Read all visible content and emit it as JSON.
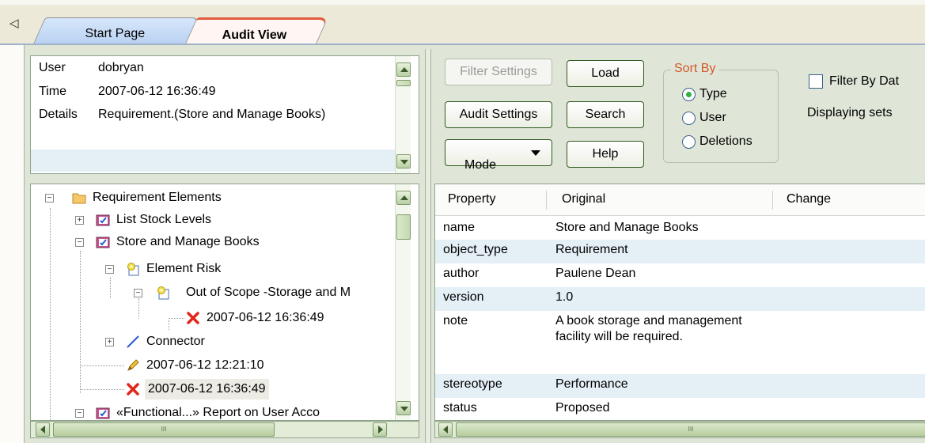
{
  "tabs": {
    "left_arrow": "◁",
    "items": [
      {
        "label": "Start Page",
        "active": false
      },
      {
        "label": "Audit View",
        "active": true
      }
    ]
  },
  "details": {
    "rows": [
      {
        "label": "User",
        "value": "dobryan"
      },
      {
        "label": "Time",
        "value": "2007-06-12 16:36:49"
      },
      {
        "label": "Details",
        "value": "Requirement.(Store and Manage Books)"
      }
    ]
  },
  "tree": {
    "nodes": [
      {
        "label": "Requirement Elements",
        "icon": "folder-icon",
        "expander": "−"
      },
      {
        "label": "List Stock Levels",
        "icon": "requirement-icon",
        "expander": "+"
      },
      {
        "label": "Store and Manage Books",
        "icon": "requirement-icon",
        "expander": "−"
      },
      {
        "label": "Element Risk",
        "icon": "risk-icon",
        "expander": "−"
      },
      {
        "label": "Out of Scope -Storage and M",
        "icon": "risk-icon",
        "expander": "−"
      },
      {
        "label": "2007-06-12 16:36:49",
        "icon": "delete-x-icon",
        "expander": ""
      },
      {
        "label": "Connector",
        "icon": "connector-icon",
        "expander": "+"
      },
      {
        "label": "2007-06-12 12:21:10",
        "icon": "pencil-icon",
        "expander": ""
      },
      {
        "label": "2007-06-12 16:36:49",
        "icon": "delete-x-icon",
        "expander": ""
      },
      {
        "label": "«Functional...» Report on User Acco",
        "icon": "requirement-icon",
        "expander": "−"
      }
    ]
  },
  "toolbar": {
    "filter_settings": "Filter Settings",
    "audit_settings": "Audit Settings",
    "mode": "Mode",
    "load": "Load",
    "search": "Search",
    "help": "Help",
    "filter_by_date": "Filter By Dat",
    "displaying_sets": "Displaying sets"
  },
  "sort_by": {
    "title": "Sort By",
    "options": [
      {
        "label": "Type",
        "selected": true
      },
      {
        "label": "User",
        "selected": false
      },
      {
        "label": "Deletions",
        "selected": false
      }
    ]
  },
  "grid": {
    "columns": [
      "Property",
      "Original",
      "Change"
    ],
    "rows": [
      {
        "property": "name",
        "original": "Store and Manage Books",
        "change": ""
      },
      {
        "property": "object_type",
        "original": "Requirement",
        "change": ""
      },
      {
        "property": "author",
        "original": "Paulene Dean",
        "change": ""
      },
      {
        "property": "version",
        "original": "1.0",
        "change": ""
      },
      {
        "property": "note",
        "original": "A book storage and management facility will be required.",
        "change": ""
      },
      {
        "property": "stereotype",
        "original": "Performance",
        "change": ""
      },
      {
        "property": "status",
        "original": "Proposed",
        "change": ""
      }
    ]
  },
  "scroll": {
    "thumb_grip": "III"
  }
}
